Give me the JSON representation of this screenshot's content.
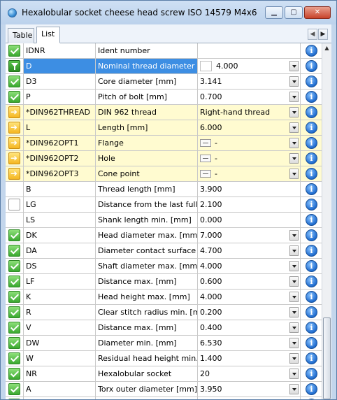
{
  "window": {
    "title": "Hexalobular socket cheese head screw ISO 14579 M4x6"
  },
  "tabs": [
    {
      "label": "Table"
    },
    {
      "label": "List"
    }
  ],
  "rows": [
    {
      "status": "check",
      "code": "IDNR",
      "desc": "Ident number",
      "value": "",
      "dropdown": false
    },
    {
      "status": "filter",
      "code": "D",
      "desc": "Nominal thread diameter [...",
      "value": "4.000",
      "dropdown": true,
      "selected": true
    },
    {
      "status": "check",
      "code": "D3",
      "desc": "Core diameter [mm]",
      "value": "3.141",
      "dropdown": true
    },
    {
      "status": "check",
      "code": "P",
      "desc": "Pitch of bolt [mm]",
      "value": "0.700",
      "dropdown": true
    },
    {
      "status": "arrow",
      "code": "*DIN962THREAD",
      "desc": "DIN 962 thread",
      "value": "Right-hand thread",
      "dropdown": true,
      "yellow": true
    },
    {
      "status": "arrow",
      "code": "L",
      "desc": "Length [mm]",
      "value": "6.000",
      "dropdown": true,
      "yellow": true
    },
    {
      "status": "arrow",
      "code": "*DIN962OPT1",
      "desc": "Flange",
      "value": "-",
      "dropdown": true,
      "yellow": true,
      "opt": true
    },
    {
      "status": "arrow",
      "code": "*DIN962OPT2",
      "desc": "Hole",
      "value": "-",
      "dropdown": true,
      "yellow": true,
      "opt": true
    },
    {
      "status": "arrow",
      "code": "*DIN962OPT3",
      "desc": "Cone point",
      "value": "-",
      "dropdown": true,
      "yellow": true,
      "opt": true
    },
    {
      "status": "none",
      "code": "B",
      "desc": "Thread length [mm]",
      "value": "3.900",
      "dropdown": false
    },
    {
      "status": "empty",
      "code": "LG",
      "desc": "Distance from the last full ...",
      "value": "2.100",
      "dropdown": false
    },
    {
      "status": "none",
      "code": "LS",
      "desc": "Shank length min. [mm]",
      "value": "0.000",
      "dropdown": false
    },
    {
      "status": "check",
      "code": "DK",
      "desc": "Head diameter max. [mm]",
      "value": "7.000",
      "dropdown": true
    },
    {
      "status": "check",
      "code": "DA",
      "desc": "Diameter contact surface ...",
      "value": "4.700",
      "dropdown": true
    },
    {
      "status": "check",
      "code": "DS",
      "desc": "Shaft diameter max. [mm]",
      "value": "4.000",
      "dropdown": true
    },
    {
      "status": "check",
      "code": "LF",
      "desc": "Distance max. [mm]",
      "value": "0.600",
      "dropdown": true
    },
    {
      "status": "check",
      "code": "K",
      "desc": "Head height max. [mm]",
      "value": "4.000",
      "dropdown": true
    },
    {
      "status": "check",
      "code": "R",
      "desc": "Clear stitch radius min. [mm]",
      "value": "0.200",
      "dropdown": true
    },
    {
      "status": "check",
      "code": "V",
      "desc": "Distance max. [mm]",
      "value": "0.400",
      "dropdown": true
    },
    {
      "status": "check",
      "code": "DW",
      "desc": "Diameter min. [mm]",
      "value": "6.530",
      "dropdown": true
    },
    {
      "status": "check",
      "code": "W",
      "desc": "Residual head height min. ...",
      "value": "1.400",
      "dropdown": true
    },
    {
      "status": "check",
      "code": "NR",
      "desc": "Hexalobular socket",
      "value": "20",
      "dropdown": true
    },
    {
      "status": "check",
      "code": "A",
      "desc": "Torx outer diameter [mm]",
      "value": "3.950",
      "dropdown": true
    },
    {
      "status": "check",
      "code": "",
      "desc": "",
      "value": "",
      "dropdown": false
    }
  ],
  "scrollbar": {
    "position": 0.77
  },
  "colors": {
    "selection": "#3d8ee3",
    "highlight_row": "#fffbd0",
    "info_icon": "#1f6ccf"
  }
}
